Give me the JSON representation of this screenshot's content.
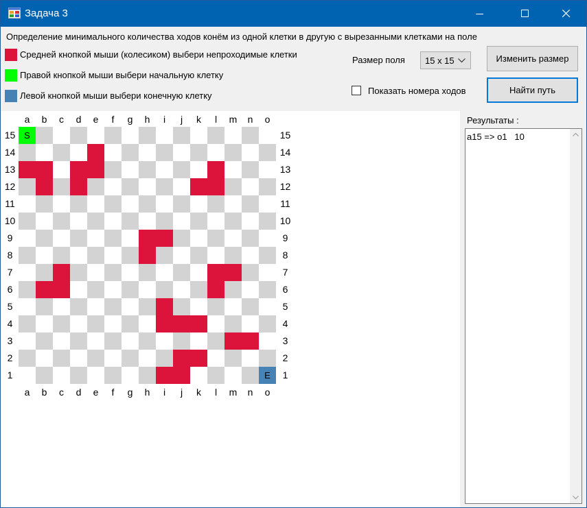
{
  "window": {
    "title": "Задача 3"
  },
  "description": "Определение минимального количества ходов конём из одной клетки в другую с вырезанными клетками на поле",
  "legend": [
    {
      "label": "Средней кнопкой мыши (колесиком) выбери непроходимые клетки",
      "color": "#dc143c"
    },
    {
      "label": "Правой кнопкой мыши выбери начальную клетку",
      "color": "#00ff00"
    },
    {
      "label": "Левой кнопкой мыши выбери конечную клетку",
      "color": "#4682b4"
    }
  ],
  "size": {
    "label": "Размер поля",
    "value": "15 x 15"
  },
  "buttons": {
    "resize": "Изменить размер",
    "find": "Найти путь"
  },
  "show_moves": {
    "label": "Показать номера ходов",
    "checked": false
  },
  "results": {
    "label": "Результаты :",
    "text": "a15 => o1   10"
  },
  "board": {
    "size": 15,
    "columns": [
      "a",
      "b",
      "c",
      "d",
      "e",
      "f",
      "g",
      "h",
      "i",
      "j",
      "k",
      "l",
      "m",
      "n",
      "o"
    ],
    "rows": [
      "15",
      "14",
      "13",
      "12",
      "11",
      "10",
      "9",
      "8",
      "7",
      "6",
      "5",
      "4",
      "3",
      "2",
      "1"
    ],
    "start": {
      "cell": "a15",
      "mark": "S"
    },
    "end": {
      "cell": "o1",
      "mark": "E"
    },
    "blocked": [
      "e14",
      "a13",
      "b13",
      "d13",
      "e13",
      "l13",
      "b12",
      "d12",
      "k12",
      "l12",
      "h9",
      "i9",
      "h8",
      "c7",
      "l7",
      "m7",
      "b6",
      "c6",
      "l6",
      "i5",
      "i4",
      "j4",
      "k4",
      "m3",
      "n3",
      "j2",
      "k2",
      "i1",
      "j1"
    ],
    "colors": {
      "light": "#ffffff",
      "dark": "#d3d3d3",
      "blocked": "#dc143c",
      "start": "#00ff00",
      "end": "#4682b4"
    }
  }
}
